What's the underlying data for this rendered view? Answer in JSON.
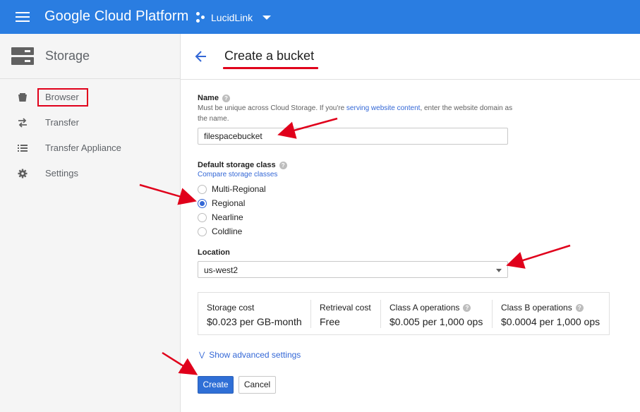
{
  "app": {
    "brand": "Google Cloud Platform",
    "project": "LucidLink"
  },
  "sidebar": {
    "title": "Storage",
    "items": [
      {
        "label": "Browser",
        "icon": "bucket-icon",
        "highlighted": true
      },
      {
        "label": "Transfer",
        "icon": "transfer-arrows-icon"
      },
      {
        "label": "Transfer Appliance",
        "icon": "list-icon"
      },
      {
        "label": "Settings",
        "icon": "gear-icon"
      }
    ]
  },
  "page": {
    "title": "Create a bucket"
  },
  "form": {
    "name": {
      "label": "Name",
      "hint_before": "Must be unique across Cloud Storage. If you're ",
      "hint_link": "serving website content",
      "hint_after": ", enter the website domain as the name.",
      "value": "filespacebucket"
    },
    "storage_class": {
      "label": "Default storage class",
      "compare_link": "Compare storage classes",
      "options": [
        "Multi-Regional",
        "Regional",
        "Nearline",
        "Coldline"
      ],
      "selected": "Regional"
    },
    "location": {
      "label": "Location",
      "value": "us-west2"
    },
    "costs": [
      {
        "title": "Storage cost",
        "value": "$0.023 per GB-month",
        "help": false
      },
      {
        "title": "Retrieval cost",
        "value": "Free",
        "help": false
      },
      {
        "title": "Class A operations",
        "value": "$0.005 per 1,000 ops",
        "help": true
      },
      {
        "title": "Class B operations",
        "value": "$0.0004 per 1,000 ops",
        "help": true
      }
    ],
    "advanced_link": "Show advanced settings",
    "create_label": "Create",
    "cancel_label": "Cancel"
  },
  "colors": {
    "topbar": "#2a7de1",
    "accent": "#3367d6",
    "annotation_red": "#e0001b"
  }
}
